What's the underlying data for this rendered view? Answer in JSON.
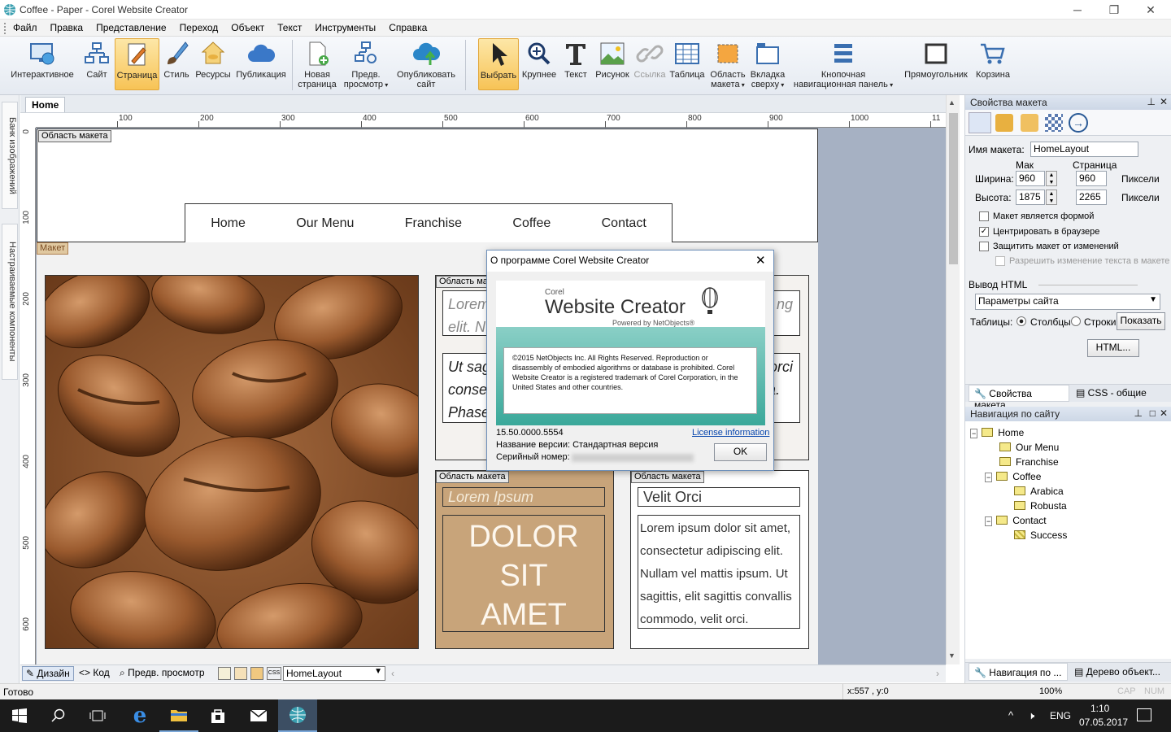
{
  "window": {
    "title": "Coffee - Paper - Corel Website Creator",
    "minimize": "─",
    "maximize": "❐",
    "close": "✕"
  },
  "menu": [
    "Файл",
    "Правка",
    "Представление",
    "Переход",
    "Объект",
    "Текст",
    "Инструменты",
    "Справка"
  ],
  "toolbar": {
    "interactive": "Интерактивное",
    "site": "Сайт",
    "page": "Страница",
    "style": "Стиль",
    "assets": "Ресурсы",
    "publish": "Публикация",
    "new_page_1": "Новая",
    "new_page_2": "страница",
    "preview_1": "Предв.",
    "preview_2": "просмотр",
    "publish_site_1": "Опубликовать",
    "publish_site_2": "сайт",
    "select": "Выбрать",
    "zoom": "Крупнее",
    "text": "Текст",
    "picture": "Рисунок",
    "link": "Ссылка",
    "table": "Таблица",
    "layout_area_1": "Область",
    "layout_area_2": "макета",
    "tab_top_1": "Вкладка",
    "tab_top_2": "сверху",
    "button_nav_1": "Кнопочная",
    "button_nav_2": "навигационная панель",
    "rectangle": "Прямоугольник",
    "cart": "Корзина"
  },
  "left_tabs": {
    "images": "Банк изображений",
    "components": "Настраиваемые компоненты"
  },
  "doc_tab": "Home",
  "ruler": {
    "h": [
      "100",
      "200",
      "300",
      "400",
      "500",
      "600",
      "700",
      "800",
      "900",
      "1000",
      "11"
    ],
    "v": [
      "0",
      "100",
      "200",
      "300",
      "400",
      "500",
      "600"
    ]
  },
  "page": {
    "layout_area_label": "Область макета",
    "layout_label": "Макет",
    "nav": [
      "Home",
      "Our Menu",
      "Franchise",
      "Coffee",
      "Contact"
    ],
    "box1_label": "Область ма",
    "box1_text1": "Lorem",
    "box1_text1b": "elit. N",
    "box1_tail": "ng",
    "box1_text2": "Ut sag",
    "box1_text2b": "consec",
    "box1_text2c": "Phasel",
    "box1_tail2": "orci",
    "box1_tail3": "a.",
    "box2_label": "Область макета",
    "box2_title": "Lorem Ipsum",
    "box2_big1": "DOLOR",
    "box2_big2": "SIT",
    "box2_big3": "AMET",
    "box3_label": "Область макета",
    "box3_title": "Velit Orci",
    "box3_body": "Lorem ipsum dolor sit amet, consectetur adipiscing elit. Nullam vel mattis ipsum. Ut sagittis, elit sagittis convallis commodo, velit orci."
  },
  "dialog": {
    "title": "О программе Corel Website Creator",
    "brand_small": "Corel",
    "brand": "Website Creator",
    "powered": "Powered by NetObjects®",
    "copyright": "©2015 NetObjects Inc. All Rights Reserved. Reproduction or disassembly of embodied algorithms or database is prohibited. Corel Website Creator is a registered trademark of Corel Corporation, in the United States and other countries.",
    "version": "15.50.0000.5554",
    "license_link": "License information",
    "edition": "Название версии: Стандартная версия",
    "serial": "Серийный номер:",
    "ok": "OK"
  },
  "bottom": {
    "design": "Дизайн",
    "code": "Код",
    "preview": "Предв. просмотр",
    "layout_select": "HomeLayout"
  },
  "status": {
    "ready": "Готово",
    "coords": "x:557 , y:0",
    "zoom": "100%",
    "cap": "CAP",
    "num": "NUM"
  },
  "props": {
    "title": "Свойства макета",
    "name_label": "Имя макета:",
    "name_value": "HomeLayout",
    "col_max": "Мак",
    "col_page": "Страница",
    "width_label": "Ширина:",
    "width_max": "960",
    "width_page": "960",
    "height_label": "Высота:",
    "height_max": "1875",
    "height_page": "2265",
    "pixels": "Пиксели",
    "cb_form": "Макет является формой",
    "cb_center": "Центрировать в браузере",
    "cb_protect": "Защитить макет от изменений",
    "cb_allow": "Разрешить изменение текста в макете",
    "html_output": "Вывод HTML",
    "html_select": "Параметры сайта",
    "tables": "Таблицы:",
    "cols": "Столбцы",
    "rows": "Строки",
    "show": "Показать",
    "html_btn": "HTML...",
    "tab1": "Свойства макета",
    "tab2": "CSS - общие"
  },
  "sitenav": {
    "title": "Навигация по сайту",
    "items": [
      "Home",
      "Our Menu",
      "Franchise",
      "Coffee",
      "Arabica",
      "Robusta",
      "Contact",
      "Success"
    ],
    "tab1": "Навигация по ...",
    "tab2": "Дерево объект..."
  },
  "taskbar": {
    "lang": "ENG",
    "time": "1:10",
    "date": "07.05.2017"
  }
}
